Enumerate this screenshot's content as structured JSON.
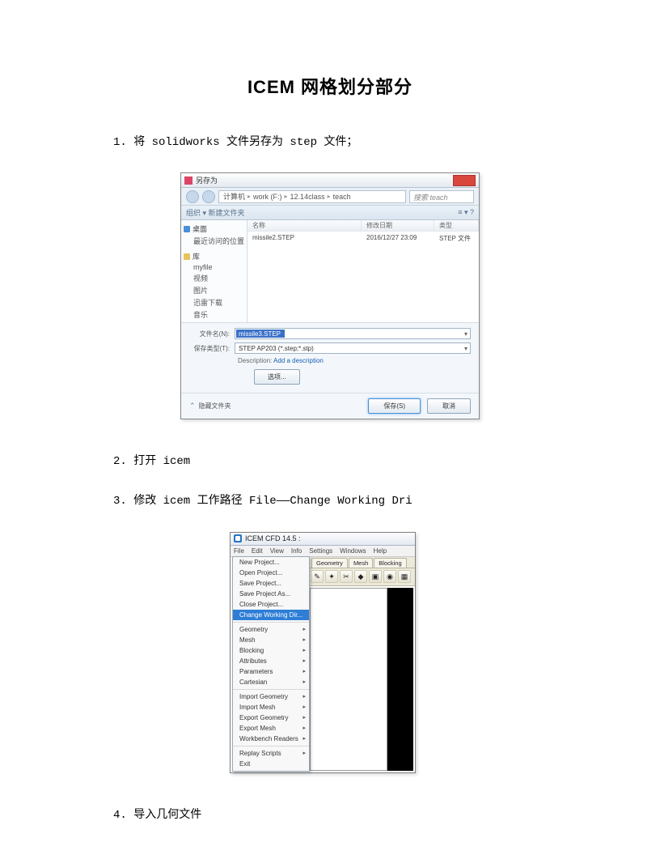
{
  "title": "ICEM 网格划分部分",
  "steps": {
    "s1": "1. 将 solidworks 文件另存为 step 文件；",
    "s2": "2. 打开 icem",
    "s3": "3. 修改 icem 工作路径 File——Change Working Dri",
    "s4": "4. 导入几何文件"
  },
  "dlg": {
    "title": "另存为",
    "breadcrumb": {
      "a": "计算机",
      "b": "work (F:)",
      "c": "12.14class",
      "d": "teach"
    },
    "search": "搜索 teach",
    "toolbar": {
      "left": "组织 ▾    新建文件夹",
      "right": "≡ ▾   ?"
    },
    "nav": {
      "g1": "桌面",
      "g1a": "最近访问的位置",
      "g2": "库",
      "g2a": "myfile",
      "g2b": "视频",
      "g2c": "图片",
      "g2d": "迅雷下载",
      "g2e": "音乐"
    },
    "cols": {
      "c1": "名称",
      "c2": "修改日期",
      "c3": "类型"
    },
    "row": {
      "r1": "missile2.STEP",
      "r2": "2016/12/27 23:09",
      "r3": "STEP 文件"
    },
    "fn_label": "文件名(N):",
    "fn_value": "missile3.STEP",
    "ft_label": "保存类型(T):",
    "ft_value": "STEP AP203 (*.step;*.stp)",
    "desc_l": "Description:",
    "desc_v": "Add a description",
    "options": "选项...",
    "hide": "隐藏文件夹",
    "save": "保存(S)",
    "cancel": "取消"
  },
  "icem": {
    "title": "ICEM CFD 14.5 :",
    "menu": {
      "a": "File",
      "b": "Edit",
      "c": "View",
      "d": "Info",
      "e": "Settings",
      "f": "Windows",
      "g": "Help"
    },
    "tabs": {
      "a": "Geometry",
      "b": "Mesh",
      "c": "Blocking"
    },
    "file": {
      "m1": "New Project...",
      "m2": "Open Project...",
      "m3": "Save Project...",
      "m4": "Save Project As...",
      "m5": "Close Project...",
      "m6": "Change Working Dir...",
      "m7": "Geometry",
      "m8": "Mesh",
      "m9": "Blocking",
      "m10": "Attributes",
      "m11": "Parameters",
      "m12": "Cartesian",
      "m13": "Import Geometry",
      "m14": "Import Mesh",
      "m15": "Export Geometry",
      "m16": "Export Mesh",
      "m17": "Workbench Readers",
      "m18": "Replay Scripts",
      "m19": "Exit"
    }
  }
}
